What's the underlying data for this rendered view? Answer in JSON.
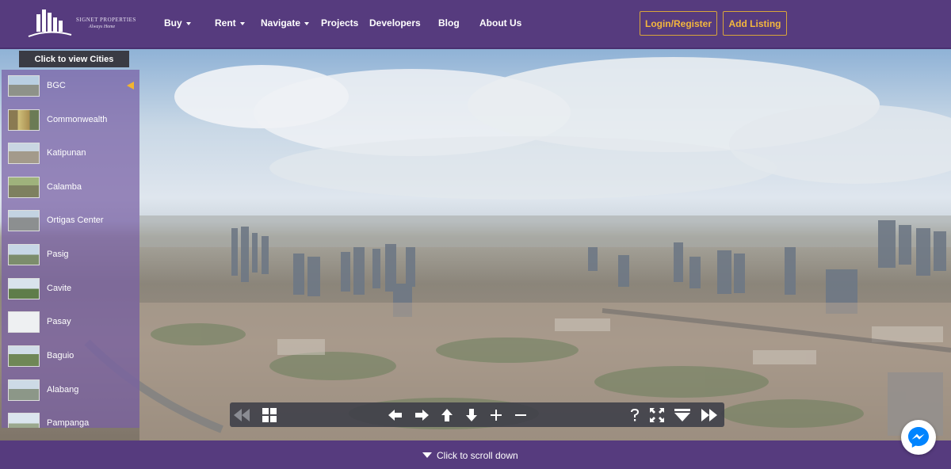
{
  "brand": {
    "name": "SIGNET PROPERTIES",
    "tagline": "Always Home"
  },
  "nav": [
    {
      "label": "Buy",
      "dropdown": true
    },
    {
      "label": "Rent",
      "dropdown": true
    },
    {
      "label": "Navigate",
      "dropdown": true
    },
    {
      "label": "Projects",
      "dropdown": false
    },
    {
      "label": "Developers",
      "dropdown": false
    },
    {
      "label": "Blog",
      "dropdown": false
    },
    {
      "label": "About Us",
      "dropdown": false
    }
  ],
  "header_buttons": {
    "login": "Login/Register",
    "add_listing": "Add Listing"
  },
  "cities": {
    "toggle_label": "Click to view Cities",
    "active": "BGC",
    "items": [
      {
        "name": "BGC"
      },
      {
        "name": "Commonwealth"
      },
      {
        "name": "Katipunan"
      },
      {
        "name": "Calamba"
      },
      {
        "name": "Ortigas Center"
      },
      {
        "name": "Pasig"
      },
      {
        "name": "Cavite"
      },
      {
        "name": "Pasay"
      },
      {
        "name": "Baguio"
      },
      {
        "name": "Alabang"
      },
      {
        "name": "Pampanga"
      }
    ]
  },
  "controls": [
    "previous-scene-icon",
    "thumbnails-icon",
    "pan-left-icon",
    "pan-right-icon",
    "pan-up-icon",
    "pan-down-icon",
    "zoom-in-icon",
    "zoom-out-icon",
    "help-icon",
    "fullscreen-icon",
    "hide-controls-icon",
    "next-scene-icon"
  ],
  "footer": {
    "scroll_label": "Click to scroll down"
  },
  "colors": {
    "brand_purple": "#563b7e",
    "accent_gold": "#f4b73d",
    "sidebar": "#785fa5",
    "controlbar": "#3c3e48",
    "messenger": "#0084ff"
  }
}
